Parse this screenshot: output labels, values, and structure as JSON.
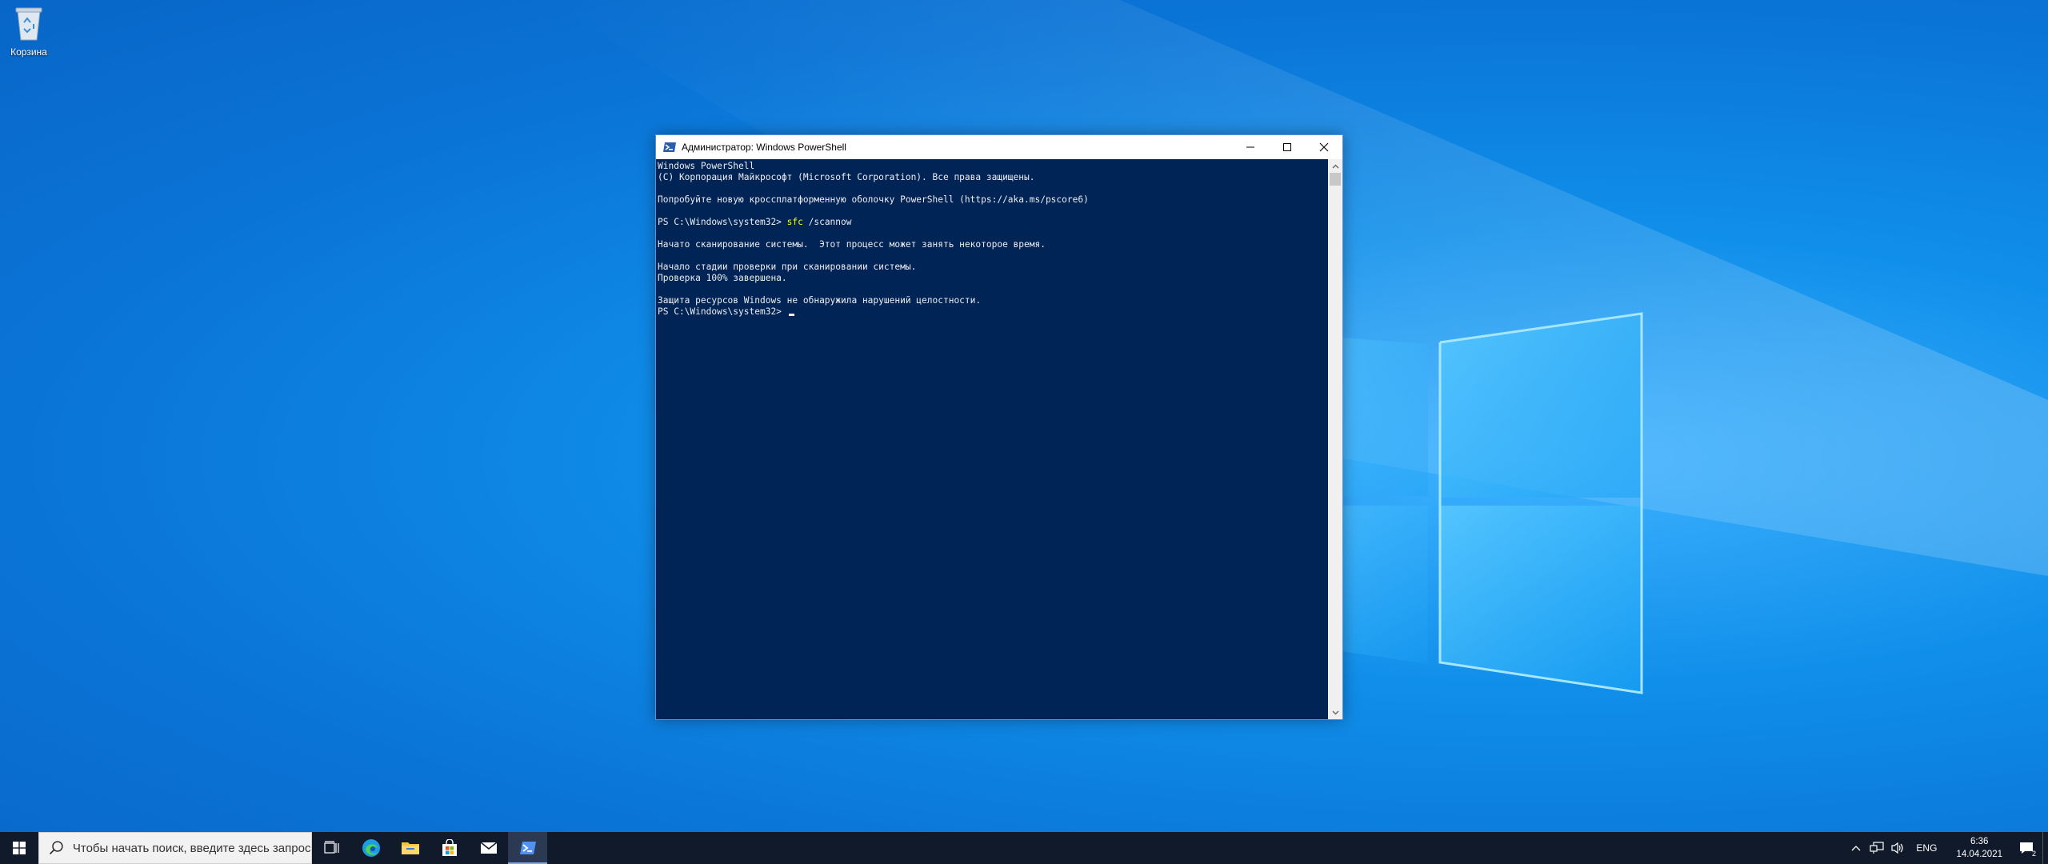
{
  "desktop": {
    "icons": [
      {
        "label": "Корзина",
        "icon": "recycle-bin-icon"
      }
    ]
  },
  "window": {
    "title": "Администратор: Windows PowerShell",
    "controls": {
      "minimize": "minimize-icon",
      "maximize": "maximize-icon",
      "close": "close-icon"
    }
  },
  "console": {
    "lines": [
      "Windows PowerShell",
      "(С) Корпорация Майкрософт (Microsoft Corporation). Все права защищены.",
      "",
      "Попробуйте новую кроссплатформенную оболочку PowerShell (https://aka.ms/pscore6)",
      ""
    ],
    "prompt1": "PS C:\\Windows\\system32> ",
    "command": "sfc",
    "command_arg": " /scannow",
    "output": [
      "",
      "Начато сканирование системы.  Этот процесс может занять некоторое время.",
      "",
      "Начало стадии проверки при сканировании системы.",
      "Проверка 100% завершена.",
      "",
      "Защита ресурсов Windows не обнаружила нарушений целостности."
    ],
    "prompt2": "PS C:\\Windows\\system32> "
  },
  "taskbar": {
    "search_placeholder": "Чтобы начать поиск, введите здесь запрос",
    "apps": [
      {
        "name": "task-view",
        "icon": "task-view-icon"
      },
      {
        "name": "edge",
        "icon": "edge-icon"
      },
      {
        "name": "file-explorer",
        "icon": "folder-icon"
      },
      {
        "name": "store",
        "icon": "store-icon"
      },
      {
        "name": "mail",
        "icon": "mail-icon"
      },
      {
        "name": "powershell",
        "icon": "powershell-icon",
        "active": true
      }
    ],
    "tray": {
      "language": "ENG",
      "time": "6:36",
      "date": "14.04.2021",
      "notifications": "2"
    }
  },
  "colors": {
    "console_bg": "#012456",
    "console_fg": "#eeedf0",
    "command": "#ffff00",
    "taskbar_bg": "#101a2a"
  }
}
